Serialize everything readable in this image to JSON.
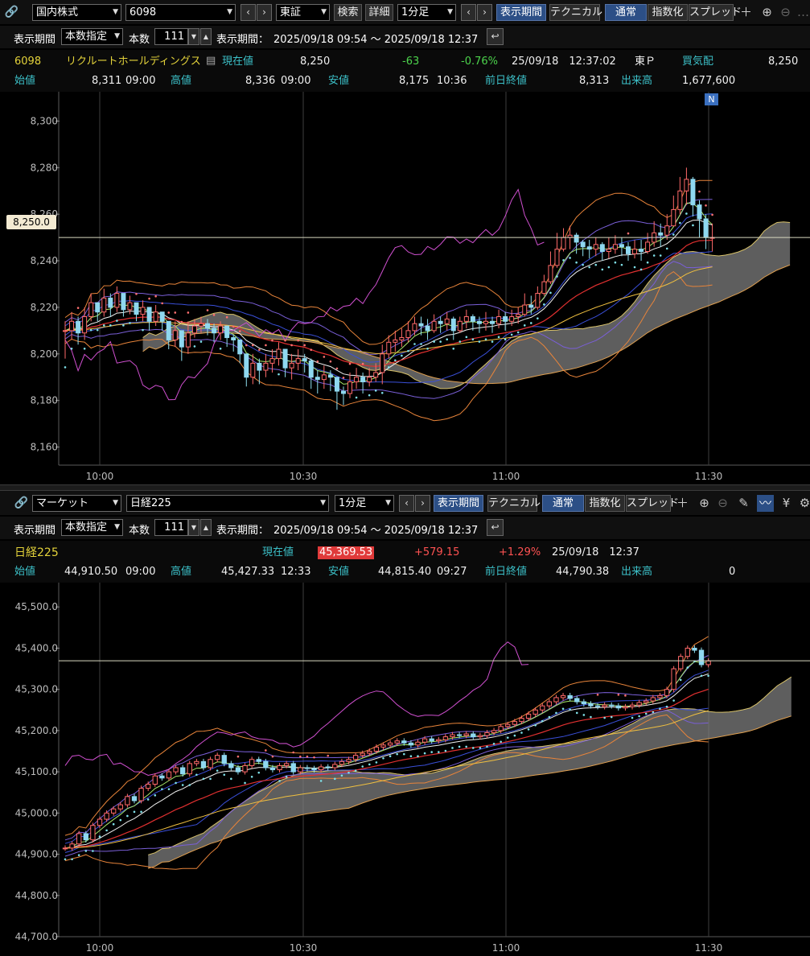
{
  "top": {
    "toolbar": {
      "market": "国内株式",
      "code": "6098",
      "exchange": "東証",
      "search": "検索",
      "detail": "詳細",
      "interval": "1分足",
      "period_btn": "表示期間",
      "technical": "テクニカル",
      "normal": "通常",
      "index": "指数化",
      "spread": "スプレッド"
    },
    "row2": {
      "period_label": "表示期間",
      "period_mode": "本数指定",
      "count_label": "本数",
      "count": "111",
      "range_label": "表示期間：",
      "range": "2025/09/18 09:54 ～ 2025/09/18 12:37"
    },
    "quote": {
      "code": "6098",
      "name": "リクルートホールディングス",
      "price_label": "現在値",
      "price": "8,250",
      "change": "-63",
      "change_pct": "-0.76%",
      "datetime": "25/09/18　12:37:02",
      "market": "東Ｐ",
      "bid_label": "買気配",
      "bid": "8,250",
      "open_label": "始値",
      "open": "8,311",
      "open_time": "09:00",
      "high_label": "高値",
      "high": "8,336",
      "high_time": "09:00",
      "low_label": "安値",
      "low": "8,175",
      "low_time": "10:36",
      "prev_label": "前日終値",
      "prev": "8,313",
      "vol_label": "出来高",
      "vol": "1,677,600"
    },
    "price_plate": "8,250.0",
    "news_badge": "N",
    "yticks": [
      "8,300",
      "8,280",
      "8,260",
      "8,240",
      "8,220",
      "8,200",
      "8,180",
      "8,160"
    ],
    "xticks": [
      "10:00",
      "10:30",
      "11:00",
      "11:30"
    ]
  },
  "bottom": {
    "toolbar": {
      "market": "マーケット",
      "index": "日経225",
      "interval": "1分足",
      "period_btn": "表示期間",
      "technical": "テクニカル",
      "normal": "通常",
      "index_btn": "指数化",
      "spread": "スプレッド"
    },
    "row2": {
      "period_label": "表示期間",
      "period_mode": "本数指定",
      "count_label": "本数",
      "count": "111",
      "range_label": "表示期間：",
      "range": "2025/09/18 09:54 ～ 2025/09/18 12:37"
    },
    "quote": {
      "name": "日経225",
      "price_label": "現在値",
      "price": "45,369.53",
      "change": "+579.15",
      "change_pct": "+1.29%",
      "datetime": "25/09/18　12:37",
      "open_label": "始値",
      "open": "44,910.50",
      "open_time": "09:00",
      "high_label": "高値",
      "high": "45,427.33",
      "high_time": "12:33",
      "low_label": "安値",
      "low": "44,815.40",
      "low_time": "09:27",
      "prev_label": "前日終値",
      "prev": "44,790.38",
      "vol_label": "出来高",
      "vol": "0"
    },
    "yticks": [
      "45,500.0",
      "45,400.0",
      "45,300.0",
      "45,200.0",
      "45,100.0",
      "45,000.0",
      "44,900.0",
      "44,800.0",
      "44,700.0"
    ],
    "xticks": [
      "10:00",
      "10:30",
      "11:00",
      "11:30"
    ]
  },
  "chart_data": [
    {
      "type": "candlestick",
      "ylim": [
        8155,
        8305
      ],
      "yticks": [
        8300,
        8280,
        8260,
        8240,
        8220,
        8200,
        8180,
        8160
      ],
      "xticks": [
        "10:00",
        "10:30",
        "11:00",
        "11:30"
      ],
      "current_price": 8250.0,
      "close": [
        8210,
        8214,
        8209,
        8216,
        8222,
        8218,
        8224,
        8220,
        8226,
        8219,
        8222,
        8217,
        8220,
        8214,
        8218,
        8214,
        8206,
        8210,
        8203,
        8209,
        8212,
        8213,
        8211,
        8209,
        8212,
        8207,
        8206,
        8200,
        8190,
        8196,
        8193,
        8196,
        8198,
        8202,
        8194,
        8196,
        8198,
        8197,
        8190,
        8189,
        8191,
        8190,
        8184,
        8183,
        8188,
        8190,
        8188,
        8190,
        8192,
        8200,
        8205,
        8206,
        8207,
        8210,
        8213,
        8212,
        8210,
        8214,
        8213,
        8215,
        8210,
        8214,
        8216,
        8214,
        8213,
        8214,
        8213,
        8216,
        8214,
        8216,
        8217,
        8221,
        8220,
        8226,
        8231,
        8238,
        8245,
        8250,
        8251,
        8248,
        8246,
        8245,
        8247,
        8244,
        8245,
        8247,
        8246,
        8243,
        8245,
        8244,
        8248,
        8252,
        8251,
        8255,
        8262,
        8270,
        8275,
        8264,
        8258,
        8250,
        8250
      ],
      "high": [
        8214,
        8218,
        8216,
        8220,
        8226,
        8222,
        8228,
        8226,
        8229,
        8226,
        8225,
        8222,
        8223,
        8220,
        8221,
        8218,
        8214,
        8214,
        8210,
        8214,
        8215,
        8216,
        8215,
        8213,
        8214,
        8212,
        8208,
        8206,
        8200,
        8200,
        8198,
        8200,
        8202,
        8205,
        8202,
        8200,
        8202,
        8200,
        8198,
        8193,
        8195,
        8193,
        8190,
        8186,
        8192,
        8194,
        8192,
        8194,
        8196,
        8204,
        8208,
        8210,
        8211,
        8214,
        8216,
        8216,
        8215,
        8217,
        8216,
        8218,
        8216,
        8216,
        8219,
        8217,
        8216,
        8218,
        8216,
        8219,
        8218,
        8219,
        8220,
        8226,
        8225,
        8229,
        8234,
        8244,
        8252,
        8254,
        8255,
        8252,
        8249,
        8249,
        8250,
        8248,
        8250,
        8251,
        8250,
        8248,
        8249,
        8249,
        8252,
        8257,
        8256,
        8260,
        8268,
        8276,
        8280,
        8276,
        8266,
        8260,
        8256
      ],
      "low": [
        8198,
        8206,
        8204,
        8206,
        8214,
        8214,
        8216,
        8216,
        8218,
        8216,
        8217,
        8214,
        8214,
        8210,
        8212,
        8210,
        8202,
        8203,
        8197,
        8200,
        8207,
        8209,
        8208,
        8205,
        8206,
        8203,
        8201,
        8196,
        8186,
        8187,
        8187,
        8190,
        8192,
        8195,
        8190,
        8189,
        8193,
        8192,
        8185,
        8183,
        8185,
        8184,
        8176,
        8178,
        8181,
        8185,
        8183,
        8186,
        8188,
        8187,
        8198,
        8201,
        8203,
        8205,
        8208,
        8208,
        8206,
        8209,
        8209,
        8210,
        8206,
        8209,
        8211,
        8210,
        8209,
        8210,
        8209,
        8211,
        8210,
        8212,
        8213,
        8216,
        8217,
        8219,
        8225,
        8230,
        8237,
        8244,
        8245,
        8243,
        8242,
        8241,
        8242,
        8240,
        8241,
        8243,
        8242,
        8240,
        8241,
        8240,
        8243,
        8246,
        8246,
        8249,
        8255,
        8260,
        8264,
        8259,
        8250,
        8245,
        8244
      ]
    },
    {
      "type": "candlestick",
      "ylim": [
        44700,
        45520
      ],
      "yticks": [
        45500,
        45400,
        45300,
        45200,
        45100,
        45000,
        44900,
        44800,
        44700
      ],
      "xticks": [
        "10:00",
        "10:30",
        "11:00",
        "11:30"
      ],
      "current_price": 45369.53,
      "close": [
        44915,
        44925,
        44950,
        44935,
        44970,
        44985,
        45000,
        45010,
        45020,
        45040,
        45030,
        45060,
        45070,
        45090,
        45085,
        45100,
        45110,
        45095,
        45120,
        45125,
        45110,
        45130,
        45140,
        45120,
        45110,
        45100,
        45115,
        45130,
        45125,
        45110,
        45105,
        45115,
        45120,
        45100,
        45110,
        45108,
        45105,
        45112,
        45110,
        45118,
        45125,
        45130,
        45140,
        45145,
        45150,
        45160,
        45165,
        45170,
        45175,
        45170,
        45165,
        45172,
        45180,
        45175,
        45178,
        45185,
        45190,
        45188,
        45192,
        45185,
        45188,
        45195,
        45200,
        45210,
        45215,
        45222,
        45230,
        45240,
        45250,
        45260,
        45270,
        45280,
        45285,
        45278,
        45270,
        45265,
        45260,
        45258,
        45262,
        45260,
        45255,
        45258,
        45262,
        45268,
        45272,
        45280,
        45285,
        45300,
        45350,
        45380,
        45400,
        45395,
        45360,
        45369
      ]
    }
  ]
}
